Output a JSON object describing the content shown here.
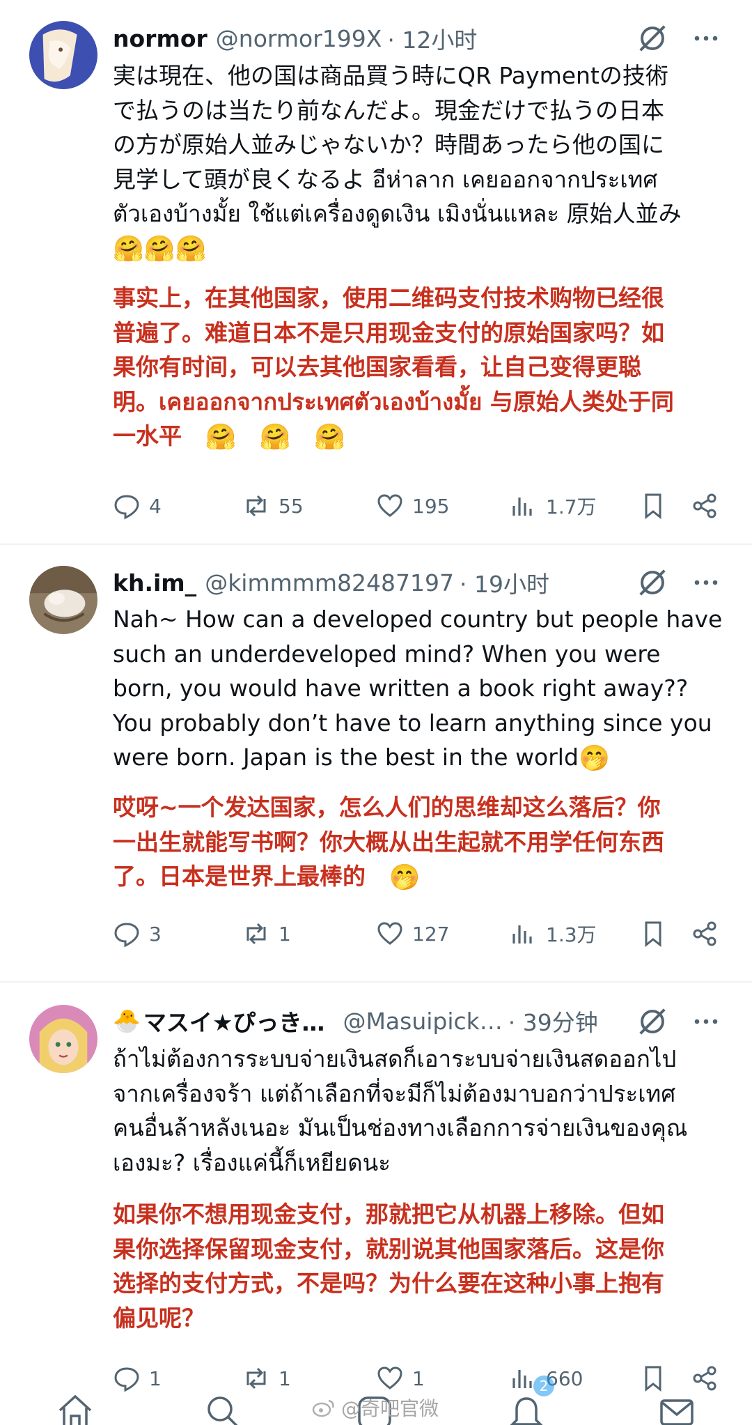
{
  "tweets": [
    {
      "name": "normor",
      "handle": "@normor199X",
      "time": "· 12小时",
      "lines": [
        "実は現在、他の国は商品買う時にQR Paymentの技術",
        "で払うのは当たり前なんだよ。現金だけで払うの日本",
        "の方が原始人並みじゃないか？時間あったら他の国に",
        "見学して頭が良くなるよ อีห่าลาก เคยออกจากประเทศ",
        "ตัวเองบ้างมั้ย ใช้แต่เครื่องดูดเงิน เมิงนั่นแหละ 原始人並み"
      ],
      "emoji_line": "🤗🤗🤗",
      "translation_lines": [
        "事实上，在其他国家，使用二维码支付技术购物已经很",
        "普遍了。难道日本不是只用现金支付的原始国家吗？如",
        "果你有时间，可以去其他国家看看，让自己变得更聪",
        "明。เคยออกจากประเทศตัวเองบ้างมั้ย 与原始人类处于同",
        "一水平"
      ],
      "translation_emojis": [
        "🤗",
        "🤗",
        "🤗"
      ],
      "replies": "4",
      "reposts": "55",
      "likes": "195",
      "views": "1.7万"
    },
    {
      "name": "kh.im_",
      "handle": "@kimmmm82487197",
      "time": "· 19小时",
      "lines": [
        "Nah~ How can a developed country but people have",
        "such an underdeveloped mind? When you were",
        "born, you would have written a book right away??",
        "You probably don’t have to learn anything since you",
        "were born. Japan is the best in the world"
      ],
      "end_emoji": "🤭",
      "translation_lines": [
        "哎呀~一个发达国家，怎么人们的思维却这么落后？你",
        "一出生就能写书啊？你大概从出生起就不用学任何东西",
        "了。日本是世界上最棒的"
      ],
      "translation_emoji": "🤭",
      "replies": "3",
      "reposts": "1",
      "likes": "127",
      "views": "1.3万"
    },
    {
      "name_prefix": "🐣",
      "name": "マスイ★ぴっき…",
      "handle": "@Masuipick…",
      "time": "· 39分钟",
      "lines": [
        "ถ้าไม่ต้องการระบบจ่ายเงินสดก็เอาระบบจ่ายเงินสดออกไป",
        "จากเครื่องจร้า แต่ถ้าเลือกที่จะมีก็ไม่ต้องมาบอกว่าประเทศ",
        "คนอื่นล้าหลังเนอะ มันเป็นช่องทางเลือกการจ่ายเงินของคุณ",
        "เองมะ? เรื่องแค่นี้ก็เหยียดนะ"
      ],
      "translation_lines": [
        "如果你不想用现金支付，那就把它从机器上移除。但如",
        "果你选择保留现金支付，就别说其他国家落后。这是你",
        "选择的支付方式，不是吗？为什么要在这种小事上抱有",
        "偏见呢？"
      ],
      "replies": "1",
      "reposts": "1",
      "likes": "1",
      "views": "660"
    }
  ],
  "watermark": "@奇吧官微",
  "notification_badge": "2",
  "colors": {
    "text": "#0f1419",
    "secondary": "#536471",
    "translation": "#c8301e",
    "divider": "#eff3f4"
  },
  "icons": [
    "grok-icon",
    "more-icon",
    "reply-icon",
    "repost-icon",
    "like-icon",
    "views-icon",
    "bookmark-icon",
    "share-icon",
    "home-icon",
    "search-icon",
    "notifications-icon",
    "messages-icon"
  ]
}
